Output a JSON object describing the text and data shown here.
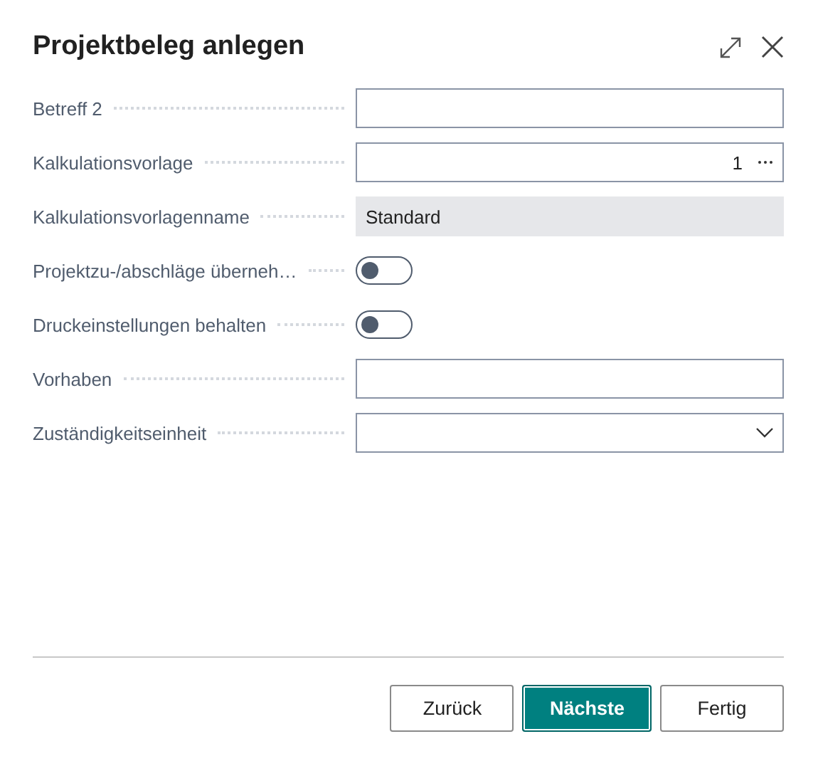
{
  "dialog": {
    "title": "Projektbeleg anlegen"
  },
  "fields": [
    {
      "kind": "text",
      "label": "Betreff 2"
    },
    {
      "kind": "lookup",
      "label": "Kalkulationsvorlage",
      "value": "1"
    },
    {
      "kind": "readonly",
      "label": "Kalkulationsvorlagenname",
      "value": "Standard"
    },
    {
      "kind": "toggle",
      "label": "Projektzu-/abschläge überneh…",
      "on": false
    },
    {
      "kind": "toggle",
      "label": "Druckeinstellungen behalten",
      "on": false
    },
    {
      "kind": "text",
      "label": "Vorhaben"
    },
    {
      "kind": "dropdown",
      "label": "Zuständigkeitseinheit"
    }
  ],
  "buttons": [
    {
      "label": "Zurück",
      "primary": false
    },
    {
      "label": "Nächste",
      "primary": true
    },
    {
      "label": "Fertig",
      "primary": false
    }
  ]
}
